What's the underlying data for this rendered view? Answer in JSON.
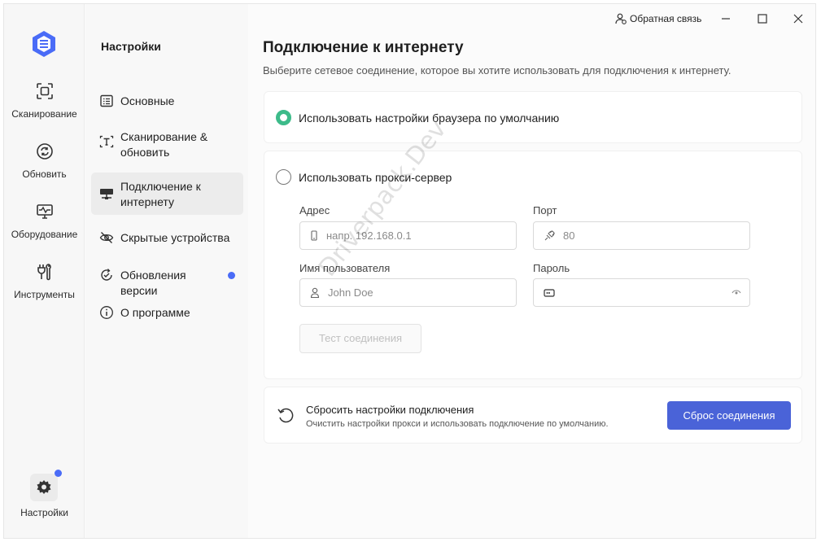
{
  "titlebar": {
    "feedback_label": "Обратная связь"
  },
  "rail": {
    "items": [
      {
        "label": "Сканирование",
        "icon": "scan-icon"
      },
      {
        "label": "Обновить",
        "icon": "refresh-icon"
      },
      {
        "label": "Оборудование",
        "icon": "monitor-pulse-icon"
      },
      {
        "label": "Инструменты",
        "icon": "tools-icon"
      }
    ],
    "settings_label": "Настройки",
    "accent": "#4a6cf7"
  },
  "nav": {
    "title": "Настройки",
    "items": [
      {
        "label": "Основные",
        "icon": "list-settings-icon"
      },
      {
        "label": "Сканирование & обновить",
        "icon": "scan-text-icon"
      },
      {
        "label": "Подключение к интернету",
        "icon": "network-icon"
      },
      {
        "label": "Скрытые устройства",
        "icon": "eye-off-icon"
      },
      {
        "label": "Обновления версии",
        "icon": "update-check-icon"
      },
      {
        "label": "О программе",
        "icon": "info-icon"
      }
    ],
    "active_index": 2
  },
  "main": {
    "title": "Подключение к интернету",
    "subtitle": "Выберите сетевое соединение, которое вы хотите использовать для подключения к интернету.",
    "option_default": "Использовать настройки браузера по умолчанию",
    "option_proxy": "Использовать прокси-сервер",
    "selected_option": "default",
    "address_label": "Адрес",
    "address_placeholder": "напр. 192.168.0.1",
    "port_label": "Порт",
    "port_placeholder": "80",
    "username_label": "Имя пользователя",
    "username_placeholder": "John Doe",
    "password_label": "Пароль",
    "password_value": "",
    "test_button": "Тест соединения",
    "reset_title": "Сбросить настройки подключения",
    "reset_desc": "Очистить настройки прокси и использовать подключение по умолчанию.",
    "reset_button": "Сброс соединения",
    "accent_green": "#3dbb8a",
    "accent_blue": "#4a63d8"
  },
  "watermark": "Driverpack.Dev"
}
